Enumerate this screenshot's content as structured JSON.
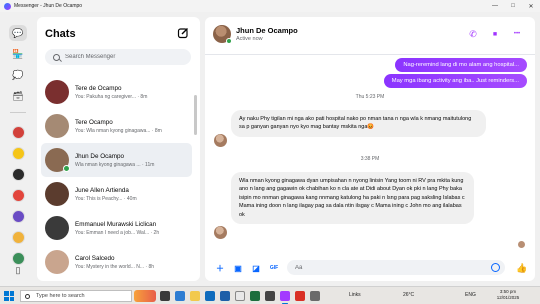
{
  "window": {
    "title": "Messenger - Jhun De Ocampo",
    "controls": [
      "—",
      "□",
      "✕"
    ]
  },
  "rail": {
    "items": [
      {
        "icon": "chat-bubble-icon",
        "glyph": "💬",
        "active": true
      },
      {
        "icon": "marketplace-icon",
        "glyph": "🏪",
        "active": false
      },
      {
        "icon": "message-requests-icon",
        "glyph": "💭",
        "active": false
      },
      {
        "icon": "archive-icon",
        "glyph": "🗃",
        "active": false
      }
    ],
    "apps": [
      "#d2413b",
      "#f5c518",
      "#2b2b2b",
      "#e2453c",
      "#6a4cc4",
      "#f0b23c",
      "#3b8f5a"
    ]
  },
  "list": {
    "title": "Chats",
    "search_placeholder": "Search Messenger",
    "chats": [
      {
        "name": "Tere de Ocampo",
        "snippet": "You: Pakuha ng caregiver... · 8m",
        "avatar_color": "#7a2f2f",
        "active": false,
        "online": false
      },
      {
        "name": "Tere Ocampo",
        "snippet": "You: Wla nman kyong ginagawa... · 8m",
        "avatar_color": "#a58a74",
        "active": false,
        "online": false
      },
      {
        "name": "Jhun De Ocampo",
        "snippet": "Wla nman kyong ginagawa ... · 11m",
        "avatar_color": "#8a6a52",
        "active": true,
        "online": true
      },
      {
        "name": "June Allen Artienda",
        "snippet": "You: This is Peachy... · 40m",
        "avatar_color": "#5b3c2e",
        "active": false,
        "online": false
      },
      {
        "name": "Emmanuel Murawski Liclican",
        "snippet": "You: Emman I need a job... Wal... · 2h",
        "avatar_color": "#3a3a3a",
        "active": false,
        "online": false
      },
      {
        "name": "Carol Salcedo",
        "snippet": "You: Mystery in the world... N... · 8h",
        "avatar_color": "#c9a58e",
        "active": false,
        "online": false
      }
    ]
  },
  "conversation": {
    "contact_name": "Jhun De Ocampo",
    "status": "Active now",
    "actions": [
      {
        "name": "phone-icon",
        "glyph": "✆"
      },
      {
        "name": "video-call-icon",
        "glyph": "■"
      },
      {
        "name": "more-icon",
        "glyph": "•••"
      }
    ],
    "outgoing_1": "Nag-reremind lang di mo alam ang hospital...",
    "outgoing_2": "May mga ibang activity ang iba.. Just reminders...",
    "timestamp_1": "Thu 5:23 PM",
    "incoming_1": "Ay naku Phy tigilan mi nga ako pati hospital nako po nman tana n nga wla k nmang maitutulong sa p ganyan ganyan nyo kyo mag bantay mskita nga😡",
    "timestamp_2": "3:38 PM",
    "incoming_2": "Wla nman kyong ginagawa dyan umpisahan n nyong linisin Yang toom ni RV pra mkita kung ano n lang ang gagawin ok chabihan ko n cla ate at Didi about Dyan ok pki n lang Phy baka isipin mo nnman ginagawa kang nnmang katulong ha paki n lsng para pag saksling Islabas c Mama ining doon n lang ilagay pag sa dala ntin ilsgay c Mama ining c John mo ang ilalabas ok",
    "composer_placeholder": "Aa"
  },
  "taskbar": {
    "search_placeholder": "Type here to search",
    "weather": "26°C",
    "tray_label": "Links",
    "lang": "ENG",
    "time": "3:50 pm",
    "date": "12/01/2025"
  }
}
